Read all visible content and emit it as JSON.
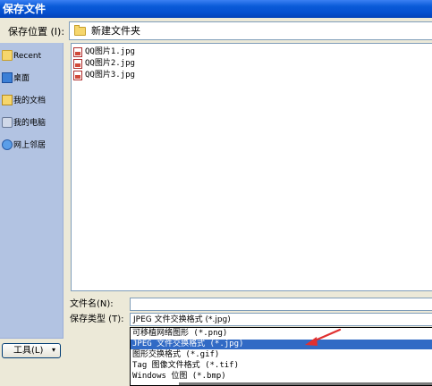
{
  "window": {
    "title": "保存文件"
  },
  "save_in": {
    "label": "保存位置 (I):",
    "value": "新建文件夹"
  },
  "places": [
    {
      "label": "Recent",
      "icon": "recent-folder-icon"
    },
    {
      "label": "桌面",
      "icon": "desktop-icon"
    },
    {
      "label": "我的文档",
      "icon": "my-documents-icon"
    },
    {
      "label": "我的电脑",
      "icon": "my-computer-icon"
    },
    {
      "label": "网上邻居",
      "icon": "network-places-icon"
    }
  ],
  "files": [
    {
      "name": "QQ图片1.jpg"
    },
    {
      "name": "QQ图片2.jpg"
    },
    {
      "name": "QQ图片3.jpg"
    }
  ],
  "filename": {
    "label": "文件名(N):",
    "value": ""
  },
  "filetype": {
    "label": "保存类型 (T):",
    "value": "JPEG 文件交换格式 (*.jpg)",
    "options": [
      "可移植网络图形 (*.png)",
      "JPEG 文件交换格式 (*.jpg)",
      "图形交换格式 (*.gif)",
      "Tag 图像文件格式 (*.tif)",
      "Windows 位图 (*.bmp)"
    ],
    "highlighted_index": 1
  },
  "tools": {
    "label": "工具(L)",
    "arrow": "▾"
  },
  "colors": {
    "title_bar": "#0550d0",
    "selection": "#316ac5",
    "annotation_arrow": "#e03030",
    "places_bar": "#b2c3e2"
  }
}
